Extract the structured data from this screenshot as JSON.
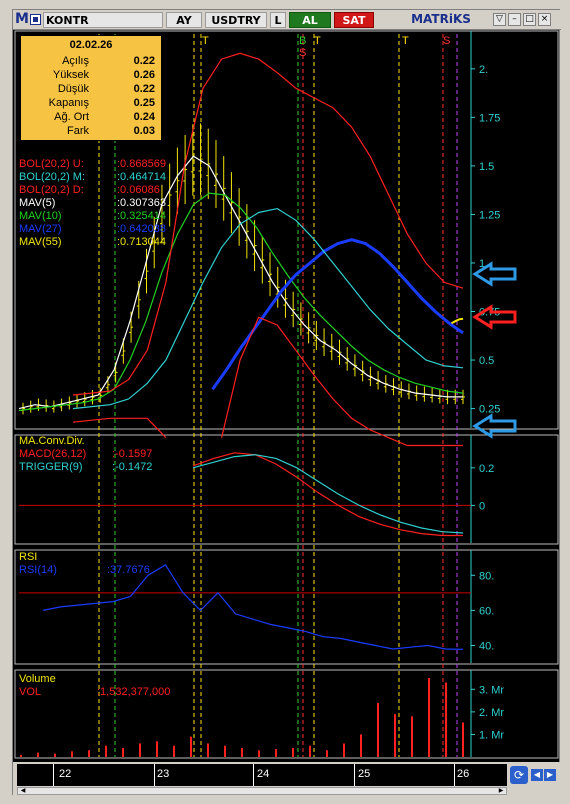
{
  "toolbar": {
    "logo": "M",
    "symbol": "KONTR",
    "period": "AY",
    "currency": "USDTRY",
    "extra": "L",
    "buy_label": "AL",
    "sell_label": "SAT",
    "brand": "MATRiKS"
  },
  "info": {
    "date": "02.02.26",
    "rows": [
      {
        "label": "Açılış",
        "value": "0.22"
      },
      {
        "label": "Yüksek",
        "value": "0.26"
      },
      {
        "label": "Düşük",
        "value": "0.22"
      },
      {
        "label": "Kapanış",
        "value": "0.25"
      },
      {
        "label": "Ağ. Ort",
        "value": "0.24"
      },
      {
        "label": "Fark",
        "value": "0.03"
      }
    ]
  },
  "legend_main": [
    {
      "name": "BOL(20,2) U:",
      "value": ":0.868569",
      "color": "#ff2020"
    },
    {
      "name": "BOL(20,2) M:",
      "value": ":0.464714",
      "color": "#2fd0d0"
    },
    {
      "name": "BOL(20,2) D:",
      "value": ":0.06086",
      "color": "#ff2020"
    },
    {
      "name": "MAV(5)",
      "value": ":0.307363",
      "color": "#ffffff"
    },
    {
      "name": "MAV(10)",
      "value": ":0.325414",
      "color": "#22d022"
    },
    {
      "name": "MAV(27)",
      "value": ":0.642038",
      "color": "#1a3cff"
    },
    {
      "name": "MAV(55)",
      "value": ":0.713044",
      "color": "#f2e600"
    }
  ],
  "legend_macd": [
    {
      "name": "MA.Conv.Div.",
      "value": "",
      "color": "#f2e600"
    },
    {
      "name": "MACD(26,12)",
      "value": ":-0.1597",
      "color": "#ff2020"
    },
    {
      "name": "TRIGGER(9)",
      "value": ":-0.1472",
      "color": "#2fd0d0"
    }
  ],
  "legend_rsi": [
    {
      "name": "RSI",
      "value": "",
      "color": "#f2e600"
    },
    {
      "name": "RSI(14)",
      "value": ":37.7676",
      "color": "#1a3cff"
    }
  ],
  "legend_vol": [
    {
      "name": "Volume",
      "value": "",
      "color": "#f2e600"
    },
    {
      "name": "VOL",
      "value": ":1,532,377,000",
      "color": "#ff2020"
    }
  ],
  "signals": [
    "T",
    "T",
    "B",
    "S",
    "T",
    "T",
    "S"
  ],
  "date_labels": [
    "22",
    "23",
    "24",
    "25",
    "26"
  ],
  "chart_data": [
    {
      "type": "line",
      "panel": "price",
      "y_ticks": [
        "0.25",
        "0.5",
        "0.75",
        "1.",
        "1.25",
        "1.5",
        "1.75",
        "2."
      ],
      "ylim": [
        0.15,
        2.2
      ],
      "x_labels": [
        "22",
        "23",
        "24",
        "25",
        "26"
      ],
      "series": [
        {
          "name": "MAV(5)",
          "color": "#ffffff",
          "values": [
            0.25,
            0.27,
            0.26,
            0.28,
            0.3,
            0.32,
            0.45,
            0.7,
            1.0,
            1.3,
            1.45,
            1.55,
            1.5,
            1.35,
            1.2,
            1.05,
            0.9,
            0.78,
            0.68,
            0.6,
            0.55,
            0.48,
            0.42,
            0.38,
            0.35,
            0.33,
            0.32,
            0.31,
            0.31
          ]
        },
        {
          "name": "MAV(10)",
          "color": "#22d022",
          "values": [
            0.24,
            0.25,
            0.26,
            0.27,
            0.28,
            0.3,
            0.35,
            0.5,
            0.7,
            0.95,
            1.15,
            1.3,
            1.36,
            1.35,
            1.28,
            1.18,
            1.05,
            0.93,
            0.82,
            0.73,
            0.65,
            0.57,
            0.5,
            0.45,
            0.41,
            0.38,
            0.36,
            0.34,
            0.33
          ]
        },
        {
          "name": "MAV(27)",
          "color": "#1a3cff",
          "values": [
            null,
            null,
            null,
            null,
            null,
            0.35,
            0.45,
            0.56,
            0.66,
            0.76,
            0.86,
            0.94,
            1.0,
            1.06,
            1.1,
            1.12,
            1.1,
            1.05,
            0.98,
            0.9,
            0.82,
            0.75,
            0.69,
            0.64
          ]
        },
        {
          "name": "MAV(55)",
          "color": "#f2e600",
          "values": [
            null,
            null,
            null,
            null,
            null,
            null,
            null,
            null,
            null,
            null,
            null,
            null,
            null,
            null,
            null,
            null,
            null,
            null,
            null,
            null,
            0.69,
            0.7,
            0.71,
            0.713
          ]
        },
        {
          "name": "BOL(20,2) U",
          "color": "#ff2020",
          "values": [
            0.32,
            0.33,
            0.34,
            0.4,
            0.55,
            0.9,
            1.5,
            1.9,
            2.05,
            2.08,
            2.05,
            1.98,
            1.9,
            1.85,
            1.8,
            1.7,
            1.55,
            1.35,
            1.15,
            1.0,
            0.9,
            0.87
          ]
        },
        {
          "name": "BOL(20,2) M",
          "color": "#2fd0d0",
          "values": [
            0.25,
            0.26,
            0.27,
            0.3,
            0.38,
            0.5,
            0.7,
            0.9,
            1.08,
            1.2,
            1.26,
            1.28,
            1.22,
            1.12,
            1.0,
            0.88,
            0.76,
            0.66,
            0.58,
            0.5,
            0.47,
            0.46
          ]
        },
        {
          "name": "BOL(20,2) D",
          "color": "#ff2020",
          "values": [
            0.18,
            0.19,
            0.2,
            0.2,
            0.2,
            0.1,
            null,
            null,
            0.1,
            0.5,
            0.72,
            0.68,
            0.55,
            0.42,
            0.3,
            0.2,
            0.14,
            0.1,
            0.06,
            0.06,
            0.06,
            0.06
          ]
        }
      ]
    },
    {
      "type": "line",
      "panel": "macd",
      "y_ticks": [
        "0.2",
        "0"
      ],
      "series": [
        {
          "name": "MACD(26,12)",
          "color": "#ff2020",
          "values": [
            0.21,
            0.25,
            0.28,
            0.27,
            0.22,
            0.15,
            0.07,
            0.0,
            -0.06,
            -0.1,
            -0.13,
            -0.15,
            -0.16,
            -0.16
          ]
        },
        {
          "name": "TRIGGER(9)",
          "color": "#2fd0d0",
          "values": [
            0.2,
            0.23,
            0.26,
            0.27,
            0.25,
            0.2,
            0.13,
            0.06,
            0.0,
            -0.05,
            -0.09,
            -0.12,
            -0.14,
            -0.147
          ]
        }
      ]
    },
    {
      "type": "line",
      "panel": "rsi",
      "y_ticks": [
        "40.",
        "60.",
        "80."
      ],
      "series": [
        {
          "name": "RSI(14)",
          "color": "#1a3cff",
          "values": [
            60,
            62,
            63,
            64,
            65,
            68,
            80,
            86,
            70,
            60,
            70,
            58,
            55,
            52,
            50,
            48,
            45,
            44,
            42,
            40,
            38,
            39,
            40,
            38,
            37.77
          ]
        }
      ]
    },
    {
      "type": "bar",
      "panel": "volume",
      "y_ticks": [
        "1. Mr",
        "2. Mr",
        "3. Mr"
      ],
      "series": [
        {
          "name": "VOL",
          "color": "#ff2020",
          "values": [
            0.1,
            0.2,
            0.15,
            0.25,
            0.3,
            0.5,
            0.4,
            0.6,
            0.7,
            0.5,
            0.9,
            0.6,
            0.5,
            0.4,
            0.3,
            0.35,
            0.4,
            0.5,
            0.3,
            0.6,
            1.0,
            2.4,
            1.9,
            1.8,
            3.5,
            3.3,
            1.53
          ]
        }
      ]
    }
  ]
}
